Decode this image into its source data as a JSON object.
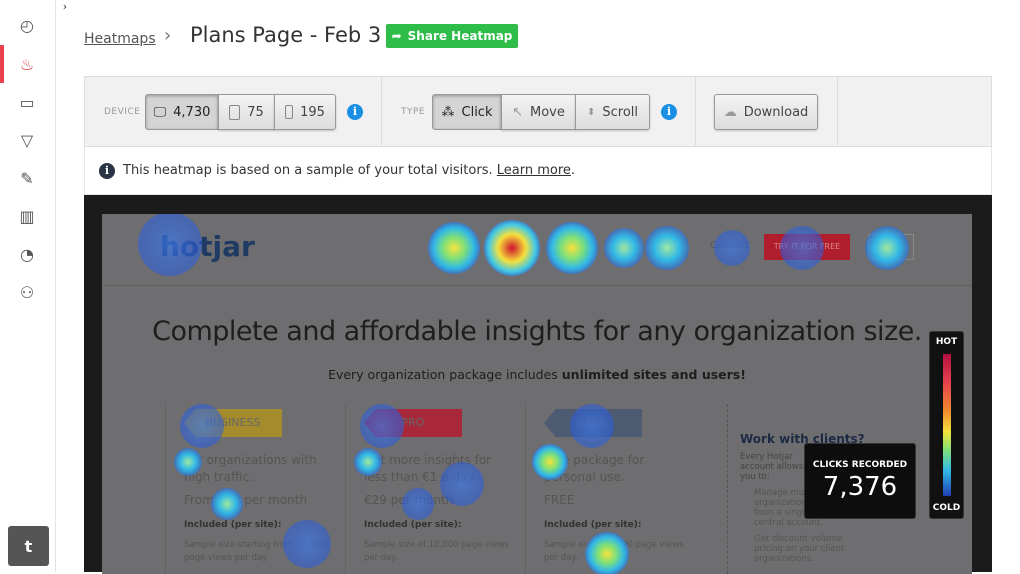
{
  "sidebar": {
    "items": [
      {
        "icon": "dashboard-icon",
        "glyph": "◴"
      },
      {
        "icon": "heatmap-flame-icon",
        "glyph": "♨"
      },
      {
        "icon": "recordings-camera-icon",
        "glyph": "▭"
      },
      {
        "icon": "funnel-icon",
        "glyph": "▽"
      },
      {
        "icon": "forms-edit-icon",
        "glyph": "✎"
      },
      {
        "icon": "polls-chart-icon",
        "glyph": "▥"
      },
      {
        "icon": "analytics-pie-icon",
        "glyph": "◔"
      },
      {
        "icon": "user-icon",
        "glyph": "⚇"
      }
    ],
    "active_index": 1,
    "twitter_glyph": "t"
  },
  "header": {
    "breadcrumb": "Heatmaps",
    "separator": "›",
    "title": "Plans Page - Feb 3",
    "share_label": "Share Heatmap"
  },
  "toolbar": {
    "device_label": "DEVICE",
    "devices": [
      {
        "icon": "desktop-icon",
        "count": "4,730",
        "selected": true
      },
      {
        "icon": "tablet-icon",
        "count": "75"
      },
      {
        "icon": "phone-icon",
        "count": "195"
      }
    ],
    "type_label": "TYPE",
    "types": [
      {
        "label": "Click",
        "selected": true
      },
      {
        "label": "Move"
      },
      {
        "label": "Scroll"
      }
    ],
    "download_label": "Download"
  },
  "notice": {
    "text": "This heatmap is based on a sample of your total visitors.",
    "link": "Learn more",
    "end": "."
  },
  "heatmap": {
    "logo": "hotjar",
    "nav_contact": "Contact",
    "nav_try": "TRY IT FOR FREE",
    "headline": "Complete and affordable insights for any organization size.",
    "sub_prefix": "Every organization package includes ",
    "sub_bold": "unlimited sites and users!",
    "plans": [
      {
        "tag": "BUSINESS",
        "color": "#a48b2c",
        "desc": "For organizations with high traffic.",
        "price": "From €89 per month",
        "inc": "Included (per site):",
        "detail": "Sample size starting from 20,000 page views per day."
      },
      {
        "tag": "PRO",
        "color": "#a8283a",
        "desc": "Get more insights for less than €1 a day.",
        "price": "€29 per month",
        "inc": "Included (per site):",
        "detail": "Sample size of 10,000 page views per day."
      },
      {
        "tag": "BASIC",
        "color": "#4c5a72",
        "desc": "Free package for personal use.",
        "price": "FREE",
        "inc": "Included (per site):",
        "detail": "Sample size of 2,000 page views per day."
      }
    ],
    "clients": {
      "title": "Work with clients?",
      "text": "Every Hotjar account allows you to:",
      "items": [
        "Manage multiple organizations from a single central account.",
        "Get discount volume pricing on your client organizations."
      ]
    },
    "legend_hot": "HOT",
    "legend_cold": "COLD",
    "clicks_label": "CLICKS RECORDED",
    "clicks_value": "7,376"
  }
}
